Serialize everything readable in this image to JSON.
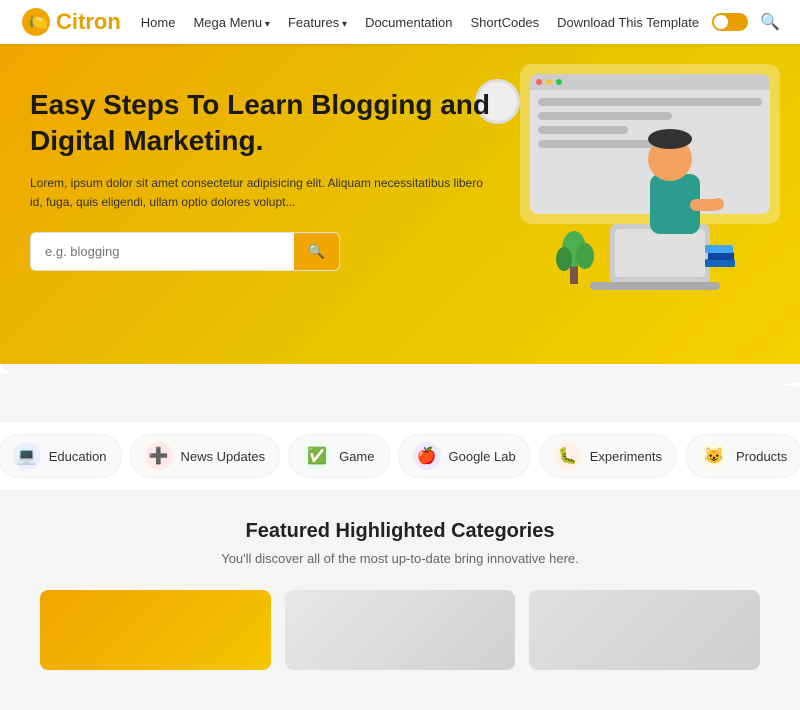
{
  "navbar": {
    "logo_text": "itron",
    "logo_c": "C",
    "links": [
      {
        "label": "Home",
        "has_arrow": false
      },
      {
        "label": "Mega Menu",
        "has_arrow": true
      },
      {
        "label": "Features",
        "has_arrow": true
      },
      {
        "label": "Documentation",
        "has_arrow": false
      },
      {
        "label": "ShortCodes",
        "has_arrow": false
      },
      {
        "label": "Download This Template",
        "has_arrow": false
      }
    ],
    "search_icon": "🔍"
  },
  "hero": {
    "title": "Easy Steps To Learn Blogging and Digital Marketing.",
    "subtitle": "Lorem, ipsum dolor sit amet consectetur adipisicing elit. Aliquam necessitatibus libero id, fuga, quis eligendi, ullam optio dolores volupt...",
    "search_placeholder": "e.g. blogging",
    "search_button_icon": "🔍"
  },
  "categories": [
    {
      "label": "Education",
      "icon": "💻",
      "icon_bg": "cat-blue"
    },
    {
      "label": "News Updates",
      "icon": "➕",
      "icon_bg": "cat-red"
    },
    {
      "label": "Game",
      "icon": "✅",
      "icon_bg": "cat-green"
    },
    {
      "label": "Google Lab",
      "icon": "🍎",
      "icon_bg": "cat-purple"
    },
    {
      "label": "Experiments",
      "icon": "🐛",
      "icon_bg": "cat-orange"
    },
    {
      "label": "Products",
      "icon": "😺",
      "icon_bg": "cat-yellow"
    }
  ],
  "featured": {
    "title": "Featured Highlighted Categories",
    "subtitle": "You'll discover all of the most up-to-date bring innovative here."
  }
}
